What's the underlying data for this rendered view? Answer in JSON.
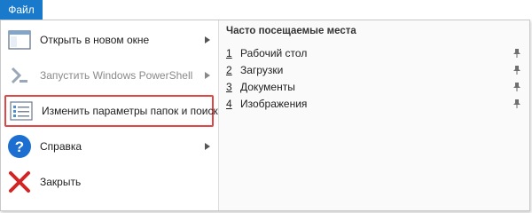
{
  "ribbon": {
    "file_tab": "Файл"
  },
  "menu": {
    "items": [
      {
        "label": "Открыть в новом окне",
        "has_submenu": true,
        "icon": "window-icon"
      },
      {
        "label": "Запустить Windows PowerShell",
        "has_submenu": true,
        "disabled": true,
        "icon": "powershell-icon"
      },
      {
        "label": "Изменить параметры папок и поиска",
        "has_submenu": false,
        "highlighted": true,
        "icon": "folder-options-icon"
      },
      {
        "label": "Справка",
        "has_submenu": true,
        "icon": "help-icon"
      },
      {
        "label": "Закрыть",
        "has_submenu": false,
        "icon": "close-icon"
      }
    ]
  },
  "frequent_places": {
    "title": "Часто посещаемые места",
    "items": [
      {
        "number": "1",
        "name": "Рабочий стол"
      },
      {
        "number": "2",
        "name": "Загрузки"
      },
      {
        "number": "3",
        "name": "Документы"
      },
      {
        "number": "4",
        "name": "Изображения"
      }
    ]
  },
  "colors": {
    "file_tab": "#1979ca",
    "highlight_border": "#e04646",
    "help_icon": "#1c6fd1",
    "close_icon": "#d12424"
  }
}
